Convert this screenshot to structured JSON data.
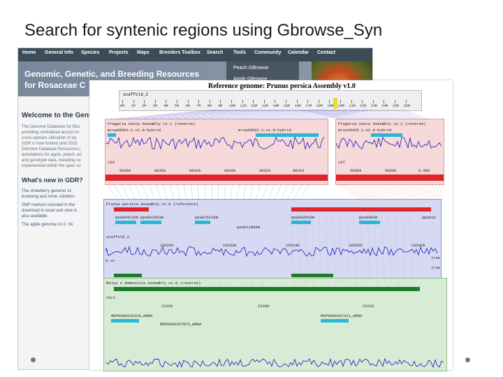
{
  "slide": {
    "title": "Search for syntenic regions using Gbrowse_Syn"
  },
  "site": {
    "nav": [
      "Home",
      "General Info",
      "Species",
      "Projects",
      "Maps",
      "Breeders Toolbox",
      "Search",
      "Tools",
      "Community",
      "Calendar",
      "Contact"
    ],
    "dropdown": [
      "Peach GBrowse",
      "Apple GBrowse"
    ],
    "banner": {
      "line1": "Genomic, Genetic, and Breeding Resources",
      "line2": "for Rosaceae C"
    },
    "welcome": "Welcome to the Geno",
    "intro_lines": [
      "The Genome Database for Ros",
      "providing centralized access to",
      "cross-species utilization of da",
      "GDR is now funded until 2015",
      "Genome Database Resources (",
      "annotations for apple, peach, an",
      "and genotype data, breeding ca",
      "implemented within the open so"
    ],
    "whats_new": "What's new in GDR?",
    "bullets": [
      "The strawberry genome v1.",
      "browsing and more. Addition",
      "SNP markers included in the",
      "download in excel and view in",
      "also available",
      "The apple genome v1.0. Ve"
    ]
  },
  "gbrowse": {
    "title": "Reference genome: Prunus persica Assembly v1.0",
    "ruler": {
      "label": "scaffold_2",
      "ticks": [
        "0M",
        "1M",
        "2M",
        "3M",
        "4M",
        "5M",
        "6M",
        "7M",
        "8M",
        "9M",
        "10M",
        "11M",
        "12M",
        "13M",
        "14M",
        "15M",
        "16M",
        "17M",
        "18M",
        "19M",
        "20M",
        "21M",
        "22M",
        "23M",
        "24M",
        "25M",
        "26M"
      ]
    },
    "top_left": {
      "label": "Fragaria vesca Assembly v1.1 (reverse)",
      "gene": "mrna09003.1-v1.0-hybrid",
      "gene2": "mrna09002.1-v1.0-hybrid",
      "chrom": "LG3",
      "coords": [
        "9836k",
        "9835k",
        "9834k",
        "9833k",
        "9832k",
        "9831k"
      ]
    },
    "top_right": {
      "label": "Fragaria vesca Assembly v1.1 (reverse)",
      "gene": "mrna19436.1-v1.0-hybrid",
      "chrom": "LG7",
      "coords": [
        "5090k",
        "5089k",
        "5.08k"
      ]
    },
    "middle": {
      "label": "Prunus persica Assembly v1.0 (reference)",
      "genes": [
        "ppa004136m",
        "ppa002953m",
        "ppa015228m",
        "ppa002666m",
        "ppa0062m",
        "ppa012"
      ],
      "gene_extra": "ppa011888m",
      "chrom": "scaffold_2",
      "coords": [
        "16526k",
        "16530k",
        "16534k",
        "16536k",
        "16540k"
      ],
      "side_labels": [
        "9.cv",
        "tree",
        "true"
      ]
    },
    "bottom": {
      "label": "Malus x domestica Assembly v1.0 (reverse)",
      "chrom": "chr2",
      "coords": [
        "2318k",
        "2320k",
        "2322k"
      ],
      "genes": [
        "MDP0000236328_mRNA",
        "MDP0000247876_mRNA",
        "MDP0000287221_mRNA"
      ]
    }
  },
  "colors": {
    "pink_track": "#f7d9d9",
    "blue_track": "#d7d9f2",
    "green_track": "#d8ebd5",
    "red_bar": "#e0242a",
    "blue_bar": "#2a2fc0",
    "green_bar": "#1f7a2a",
    "gene_cyan": "#27b8d8"
  }
}
